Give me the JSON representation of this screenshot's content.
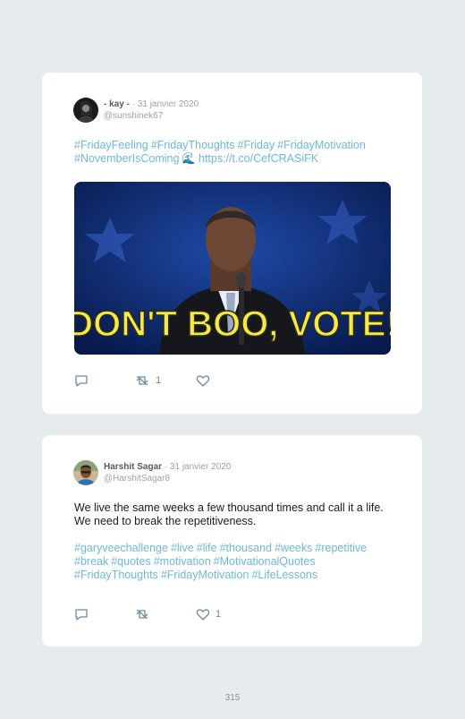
{
  "tweets": [
    {
      "author": "- kay -",
      "date": "31 janvier 2020",
      "handle": "@sunshinek67",
      "hashtags": [
        "#FridayFeeling",
        "#FridayThoughts",
        "#Friday",
        "#FridayMotivation",
        "#NovemberIsComing"
      ],
      "emoji": "🌊",
      "link": "https://t.co/CefCRASiFK",
      "media_caption": "DON'T BOO, VOTE!",
      "retweets": "1",
      "likes": ""
    },
    {
      "author": "Harshit Sagar",
      "date": "31 janvier 2020",
      "handle": "@HarshitSagar8",
      "text": "We live the same weeks a few thousand times and call it a life. We need to break the repetitiveness.",
      "hashtags": [
        "#garyveechallenge",
        "#live",
        "#life",
        "#thousand",
        "#weeks",
        "#repetitive",
        "#break",
        "#quotes",
        "#motivation",
        "#MotivationalQuotes",
        "#FridayThoughts",
        "#FridayMotivation",
        "#LifeLessons"
      ],
      "retweets": "",
      "likes": "1"
    }
  ],
  "page_number": "315",
  "colors": {
    "background": "#e6ebee",
    "card": "#ffffff",
    "hashtag": "#6cb8e3",
    "muted": "#9aa3a9"
  },
  "icons": {
    "reply": "reply-icon",
    "retweet": "retweet-icon",
    "like": "heart-icon"
  }
}
